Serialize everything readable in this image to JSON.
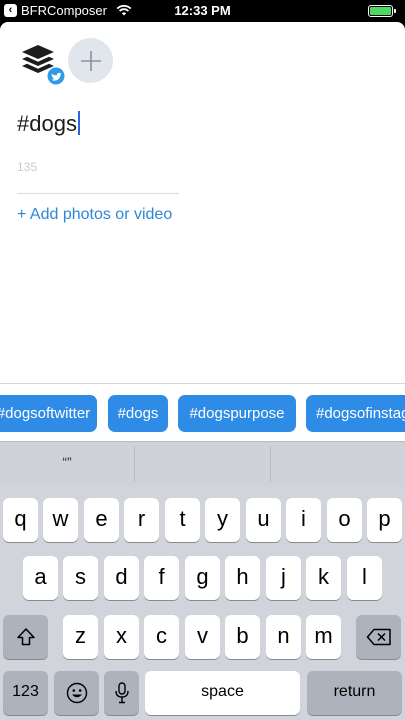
{
  "status_bar": {
    "back_app": "BFRComposer",
    "time": "12:33 PM",
    "battery_level": 1.0
  },
  "composer": {
    "profile_icon": "buffer-stack-icon",
    "profile_badge": "twitter-icon",
    "add_profile_icon": "plus-icon",
    "text": "#dogs",
    "char_count": "135",
    "add_media_label": "+ Add photos or video"
  },
  "hashtag_suggestions": [
    "#dogsoftwitter",
    "#dogs",
    "#dogspurpose",
    "#dogsofinstagram"
  ],
  "keyboard": {
    "prediction_bar": [
      "“”",
      "",
      ""
    ],
    "row1": [
      "q",
      "w",
      "e",
      "r",
      "t",
      "y",
      "u",
      "i",
      "o",
      "p"
    ],
    "row2": [
      "a",
      "s",
      "d",
      "f",
      "g",
      "h",
      "j",
      "k",
      "l"
    ],
    "row3": [
      "z",
      "x",
      "c",
      "v",
      "b",
      "n",
      "m"
    ],
    "numbers_label": "123",
    "space_label": "space",
    "return_label": "return",
    "shift_icon": "shift-icon",
    "delete_icon": "delete-icon",
    "emoji_icon": "emoji-icon",
    "mic_icon": "microphone-icon"
  },
  "colors": {
    "accent": "#2e8be6",
    "link": "#2c87d8",
    "caret": "#2c64e3",
    "battery": "#4cd964"
  }
}
